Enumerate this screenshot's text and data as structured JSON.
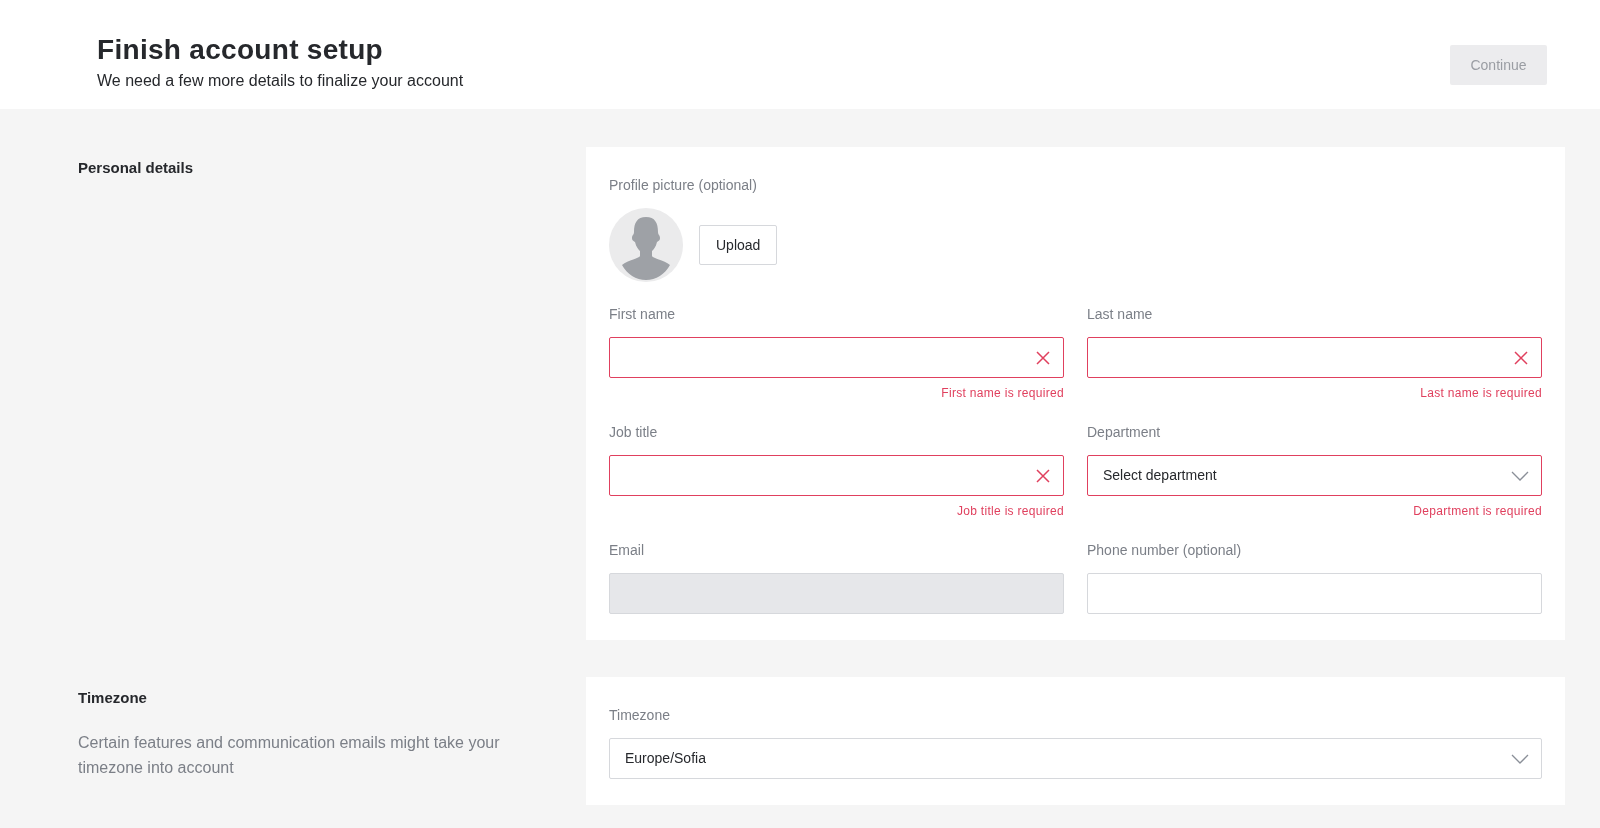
{
  "header": {
    "title": "Finish account setup",
    "subtitle": "We need a few more details to finalize your account",
    "continue_button": {
      "label": "Continue",
      "disabled": true
    }
  },
  "sections": [
    {
      "title": "Personal details",
      "profile_picture": {
        "label": "Profile picture (optional)",
        "upload_label": "Upload"
      },
      "fields": [
        {
          "kind": "text",
          "label": "First name",
          "error": "First name is required",
          "invalid": true,
          "disabled": false
        },
        {
          "kind": "text",
          "label": "Last name",
          "error": "Last name is required",
          "invalid": true,
          "disabled": false
        },
        {
          "kind": "text",
          "label": "Job title",
          "error": "Job title is required",
          "invalid": true,
          "disabled": false
        },
        {
          "kind": "select",
          "label": "Department",
          "value": "Select department",
          "error": "Department is required",
          "invalid": true,
          "disabled": false
        },
        {
          "kind": "text",
          "label": "Email",
          "invalid": false,
          "disabled": true
        },
        {
          "kind": "text",
          "label": "Phone number (optional)",
          "invalid": false,
          "disabled": false
        }
      ]
    },
    {
      "title": "Timezone",
      "description": "Certain features and communication emails might take your timezone into account",
      "fields": [
        {
          "kind": "select",
          "label": "Timezone",
          "value": "Europe/Sofia",
          "invalid": false,
          "disabled": false,
          "wide": true
        }
      ]
    }
  ]
}
